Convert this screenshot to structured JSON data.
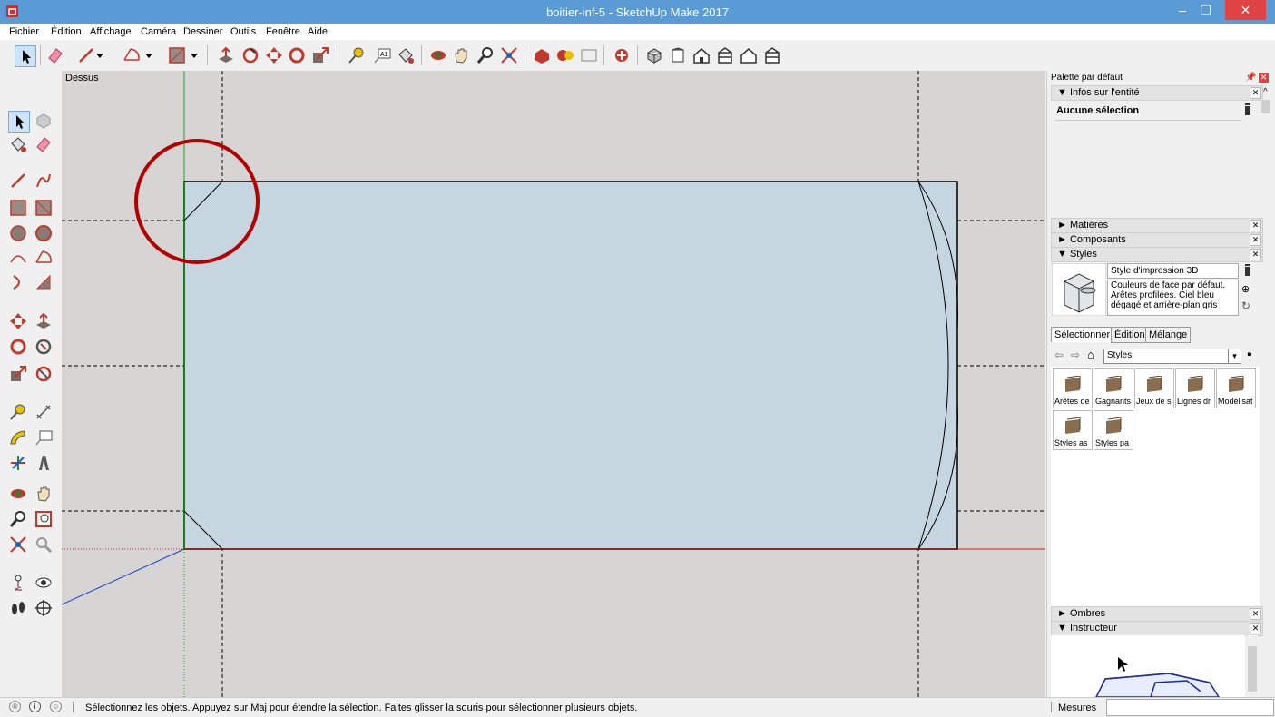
{
  "window": {
    "title": "boitier-inf-5 - SketchUp Make 2017"
  },
  "menu": [
    "Fichier",
    "Édition",
    "Affichage",
    "Caméra",
    "Dessiner",
    "Outils",
    "Fenêtre",
    "Aide"
  ],
  "viewport": {
    "scene_label": "Dessus"
  },
  "panel": {
    "title": "Palette par défaut",
    "entity_info": {
      "header": "Infos sur l'entité",
      "selection": "Aucune sélection"
    },
    "materials": {
      "header": "Matières"
    },
    "components": {
      "header": "Composants"
    },
    "styles": {
      "header": "Styles",
      "style_name": "Style d'impression 3D",
      "description": "Couleurs de face par défaut. Arêtes profilées. Ciel bleu dégagé et arrière-plan gris",
      "tabs": [
        "Sélectionner",
        "Édition",
        "Mélange"
      ],
      "library": "Styles",
      "folders": [
        "Arêtes de",
        "Gagnants",
        "Jeux de s",
        "Lignes dr",
        "Modélisat",
        "Styles as",
        "Styles pa"
      ]
    },
    "shadows": {
      "header": "Ombres"
    },
    "instructor": {
      "header": "Instructeur"
    }
  },
  "status": {
    "message": "Sélectionnez les objets. Appuyez sur Maj pour étendre la sélection. Faites glisser la souris pour sélectionner plusieurs objets.",
    "measures_label": "Mesures",
    "measures_value": ""
  },
  "colors": {
    "titlebar": "#5b9bd5",
    "face": "#c5d6e1",
    "viewport_bg": "#d7d5d3",
    "annotation": "#b50000",
    "close_red": "#e04343"
  }
}
